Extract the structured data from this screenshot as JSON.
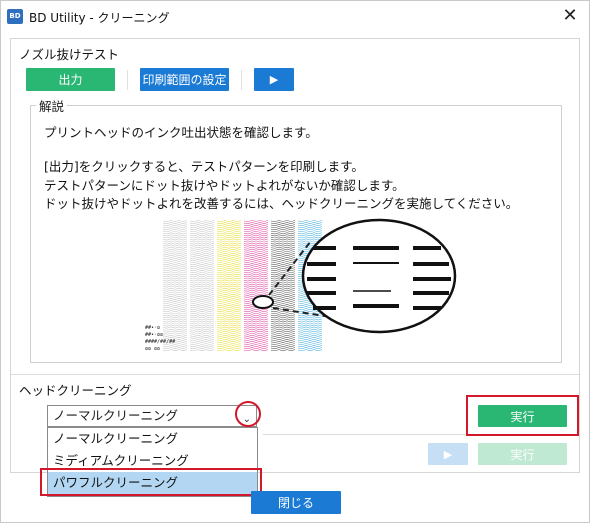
{
  "window": {
    "icon_text": "BD",
    "title": "BD Utility - クリーニング",
    "close_symbol": "✕"
  },
  "nozzle_test": {
    "title": "ノズル抜けテスト",
    "output_label": "出力",
    "print_range_label": "印刷範囲の設定",
    "play_symbol": "▶"
  },
  "explanation": {
    "legend": "解説",
    "lines": [
      "プリントヘッドのインク吐出状態を確認します。",
      "[出力]をクリックすると、テストパターンを印刷します。",
      "テストパターンにドット抜けやドットよれがないか確認します。",
      "ドット抜けやドットよれを改善するには、ヘッドクリーニングを実施してください。"
    ]
  },
  "illustration": {
    "stripe_colors": [
      "#c8c8c8",
      "#c8c8c8",
      "#e9df3e",
      "#e04fa4",
      "#5f5f5f",
      "#53b5e0"
    ],
    "label_lines": [
      "##•·ʘ",
      "##•·ʘʘ",
      "####/##/##",
      "ʘʘ ʘʘ"
    ]
  },
  "head_cleaning": {
    "title": "ヘッドクリーニング",
    "selected_value": "ノーマルクリーニング",
    "dropdown_arrow": "⌄",
    "options": [
      "ノーマルクリーニング",
      "ミディアムクリーニング",
      "パワフルクリーニング"
    ],
    "execute_label": "実行",
    "secondary_play_symbol": "▶",
    "secondary_execute_label": "実行"
  },
  "footer": {
    "close_label": "閉じる"
  },
  "colors": {
    "green": "#2ab673",
    "blue": "#1a7ad4",
    "highlight_red": "#d3182b",
    "option_highlight": "#b3d7f2"
  }
}
